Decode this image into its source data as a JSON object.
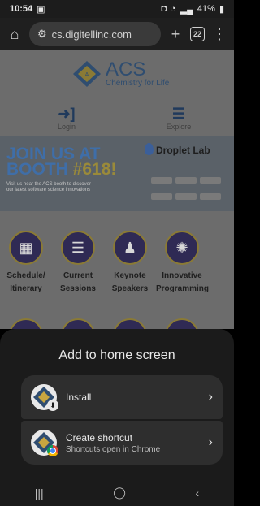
{
  "status_bar": {
    "time": "10:54",
    "battery": "41%",
    "icons": [
      "gallery-icon",
      "screenshot-icon",
      "wifi-icon",
      "signal-icon",
      "battery-icon"
    ]
  },
  "browser": {
    "url": "cs.digitellinc.com",
    "tab_count": "22",
    "icons": [
      "home-icon",
      "site-info-icon",
      "new-tab-icon",
      "tab-switcher-icon",
      "menu-icon"
    ]
  },
  "website": {
    "logo_title": "ACS",
    "logo_tagline": "Chemistry for Life",
    "nav": [
      {
        "label": "Login",
        "icon": "login-icon"
      },
      {
        "label": "Explore",
        "icon": "hamburger-icon"
      }
    ],
    "banner": {
      "headline_1": "JOIN US AT",
      "headline_2_a": "BOOTH",
      "headline_2_b": "#618!",
      "subtext": "Visit us near the ACS booth to discover our latest software science innovations",
      "sponsor": "Droplet Lab"
    },
    "quick_links": [
      {
        "line1": "Schedule/",
        "line2": "Itinerary",
        "icon": "calendar-check-icon"
      },
      {
        "line1": "Current",
        "line2": "Sessions",
        "icon": "list-icon"
      },
      {
        "line1": "Keynote",
        "line2": "Speakers",
        "icon": "speaker-podium-icon"
      },
      {
        "line1": "Innovative",
        "line2": "Programming",
        "icon": "lightbulb-icon"
      }
    ]
  },
  "sheet": {
    "title": "Add to home screen",
    "options": [
      {
        "title": "Install",
        "subtitle": "",
        "badge": "install-icon"
      },
      {
        "title": "Create shortcut",
        "subtitle": "Shortcuts open in Chrome",
        "badge": "chrome-icon"
      }
    ]
  },
  "system_nav": {
    "icons": [
      "recents-icon",
      "home-button-icon",
      "back-icon"
    ]
  },
  "colors": {
    "sheet_bg": "#1b1b1b",
    "option_bg": "#2e2e2e",
    "acs_blue": "#2f4d70",
    "circle_fill": "#2f2a54",
    "circle_ring": "#8a7a35"
  }
}
